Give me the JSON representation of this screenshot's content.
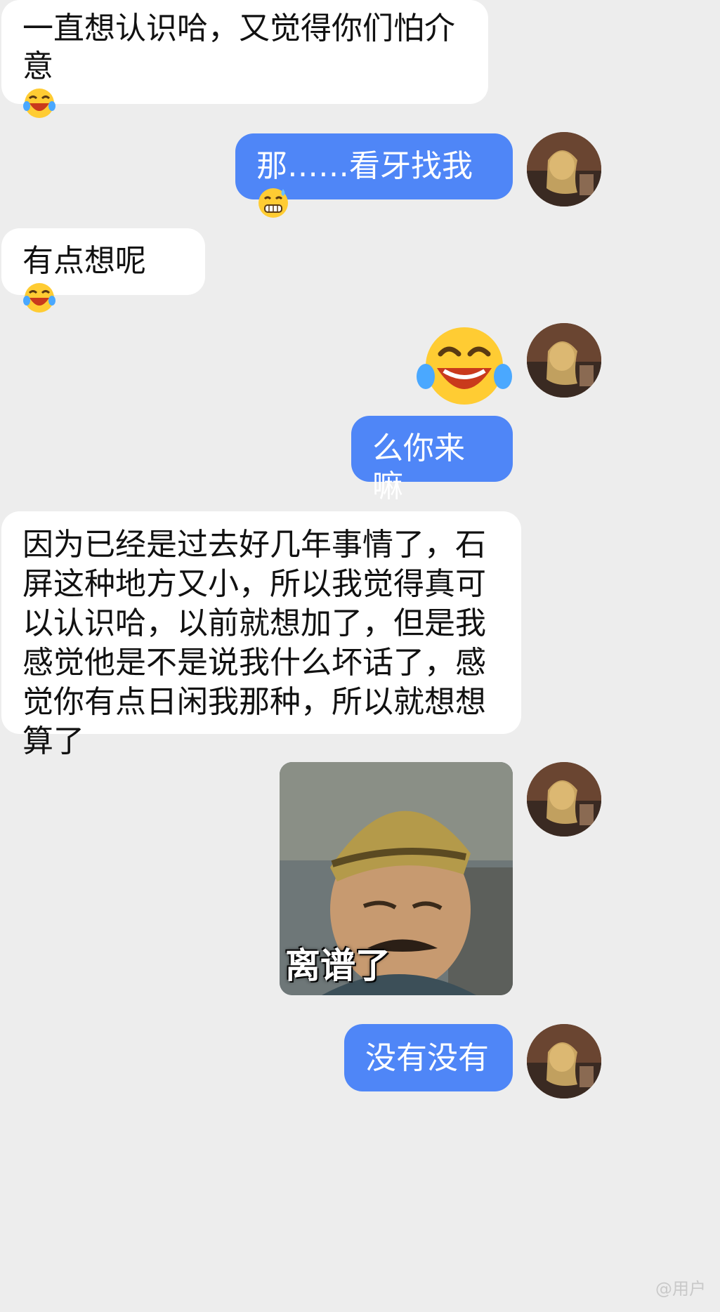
{
  "messages": [
    {
      "side": "left",
      "text": "一直想认识哈，又觉得你们怕介意",
      "emoji": "laughing-crying-emoji"
    },
    {
      "side": "right",
      "text": "那……看牙找我",
      "emoji": "grimacing-sweat-emoji"
    },
    {
      "side": "left",
      "text": "有点想呢",
      "emoji": "laughing-crying-emoji"
    },
    {
      "side": "right",
      "type": "big-emoji",
      "emoji": "laughing-crying-emoji"
    },
    {
      "side": "right",
      "text": "么你来嘛"
    },
    {
      "side": "left",
      "text": "因为已经是过去好几年事情了，石屏这种地方又小，所以我觉得真可以认识哈，以前就想加了，但是我感觉他是不是说我什么坏话了，感觉你有点日闲我那种，所以就想想算了"
    },
    {
      "side": "right",
      "type": "sticker",
      "caption": "离谱了"
    },
    {
      "side": "right",
      "text": "没有没有"
    }
  ],
  "watermark": "@用户",
  "colors": {
    "background": "#ededed",
    "outgoing_bubble": "#4f86f7",
    "incoming_bubble": "#ffffff"
  }
}
